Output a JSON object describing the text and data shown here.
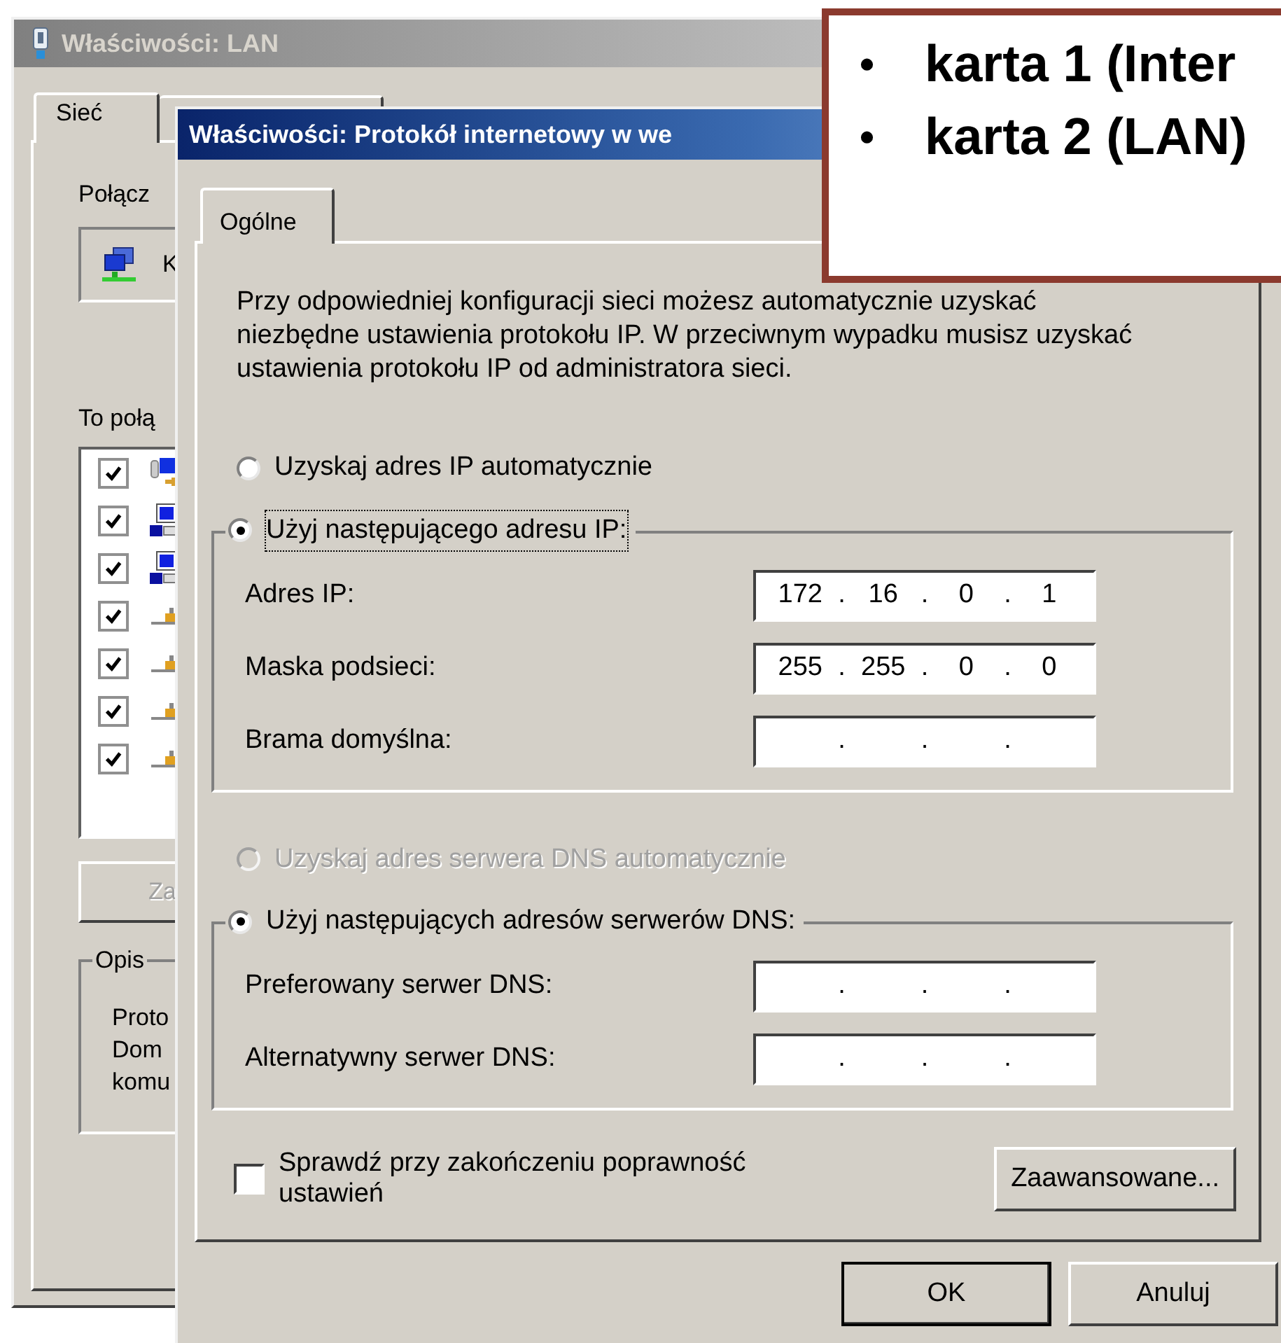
{
  "back_window": {
    "title": "Właściwości: LAN",
    "tabs": [
      {
        "label": "Sieć",
        "selected": true
      },
      {
        "selected": false
      }
    ],
    "connect_label": "Połącz",
    "adapter_text": "K",
    "components_label": "To połą",
    "components": [
      {
        "kind": "client",
        "checked": true
      },
      {
        "kind": "computer",
        "checked": true
      },
      {
        "kind": "computer",
        "checked": true
      },
      {
        "kind": "protocol",
        "checked": true
      },
      {
        "kind": "protocol",
        "checked": true
      },
      {
        "kind": "protocol",
        "checked": true
      },
      {
        "kind": "protocol",
        "checked": true
      }
    ],
    "install_button": "Za",
    "description": {
      "legend": "Opis",
      "lines": [
        "Proto",
        "Dom",
        "komu"
      ]
    }
  },
  "dialog": {
    "title": "Właściwości: Protokół internetowy w we",
    "tabs": [
      {
        "label": "Ogólne",
        "selected": true
      }
    ],
    "intro": "Przy odpowiedniej konfiguracji sieci możesz automatycznie uzyskać niezbędne ustawienia protokołu IP. W przeciwnym wypadku musisz uzyskać ustawienia protokołu IP od administratora sieci.",
    "ip_mode": [
      {
        "label": "Uzyskaj adres IP automatycznie",
        "selected": false,
        "disabled": false
      },
      {
        "label": "Użyj następującego adresu IP:",
        "selected": true,
        "disabled": false
      }
    ],
    "ip_fields": [
      {
        "label": "Adres IP:",
        "octets": [
          "172",
          "16",
          "0",
          "1"
        ],
        "dots": [
          ".",
          ".",
          "."
        ]
      },
      {
        "label": "Maska podsieci:",
        "octets": [
          "255",
          "255",
          "0",
          "0"
        ],
        "dots": [
          ".",
          ".",
          "."
        ]
      },
      {
        "label": "Brama domyślna:",
        "dots": [
          ".",
          ".",
          "."
        ]
      }
    ],
    "dns_mode": [
      {
        "label": "Uzyskaj adres serwera DNS automatycznie",
        "selected": false,
        "disabled": true
      },
      {
        "label": "Użyj następujących adresów serwerów DNS:",
        "selected": true,
        "disabled": false
      }
    ],
    "dns_fields": [
      {
        "label": "Preferowany serwer DNS:",
        "dots": [
          ".",
          ".",
          "."
        ]
      },
      {
        "label": "Alternatywny serwer DNS:",
        "dots": [
          ".",
          ".",
          "."
        ]
      }
    ],
    "validate": {
      "label": "Sprawdź przy zakończeniu poprawność ustawień",
      "checked": false
    },
    "advanced_button": "Zaawansowane...",
    "buttons": [
      "OK",
      "Anuluj"
    ]
  },
  "callout": {
    "bullets": [
      {
        "bullet": "•",
        "text": "karta 1 (Inter"
      },
      {
        "bullet": "•",
        "text": "karta 2 (LAN)"
      }
    ]
  }
}
